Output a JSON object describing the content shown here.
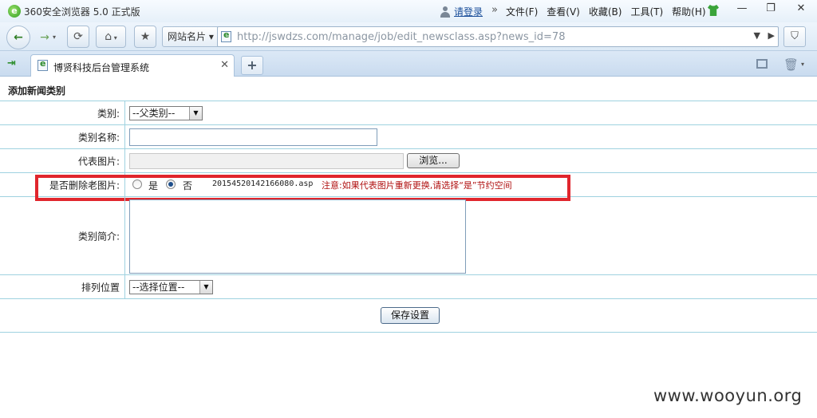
{
  "window": {
    "title": "360安全浏览器 5.0 正式版",
    "logo_glyph": "e",
    "login_label": "请登录",
    "overflow_glyph": "»",
    "menu": [
      "文件(F)",
      "查看(V)",
      "收藏(B)",
      "工具(T)",
      "帮助(H)"
    ],
    "min_glyph": "—",
    "max_glyph": "❐",
    "close_glyph": "✕"
  },
  "toolbar": {
    "back_glyph": "←",
    "forward_glyph": "→",
    "refresh_glyph": "⟳",
    "home_glyph": "⌂",
    "favorite_glyph": "★",
    "site_button": "网站名片 ▾",
    "url": "http://jswdzs.com/manage/job/edit_newsclass.asp?news_id=78",
    "dropdown_glyph": "▼",
    "go_glyph": "▶",
    "shield_glyph": "⛉"
  },
  "tabs": {
    "sidebar_glyph": "⇥",
    "active_tab_title": "博贤科技后台管理系统",
    "close_glyph": "✕",
    "new_tab_glyph": "+",
    "trash_glyph": "🗑",
    "caret_glyph": "▾"
  },
  "form": {
    "heading": "添加新闻类别",
    "type_label": "类别:",
    "type_value": "--父类别--",
    "name_label": "类别名称:",
    "name_value": "",
    "image_label": "代表图片:",
    "browse_label": "浏览...",
    "delete_label": "是否删除老图片:",
    "radio_yes": "是",
    "radio_no": "否",
    "radio_selected": "否",
    "old_file": "20154520142166080.asp",
    "note": "注意:如果代表图片重新更换,请选择“是”节约空间",
    "intro_label": "类别简介:",
    "intro_value": "",
    "order_label": "排列位置",
    "order_value": "--选择位置--",
    "save_label": "保存设置",
    "select_arrow": "▼",
    "scroll_up": "▲",
    "scroll_down": "▼"
  },
  "watermark": "www.wooyun.org",
  "colors": {
    "grid_line": "#9fd2e0",
    "highlight_frame": "#e0262d",
    "note_text": "#b01010",
    "scrollbar": "#8fd1f0"
  }
}
